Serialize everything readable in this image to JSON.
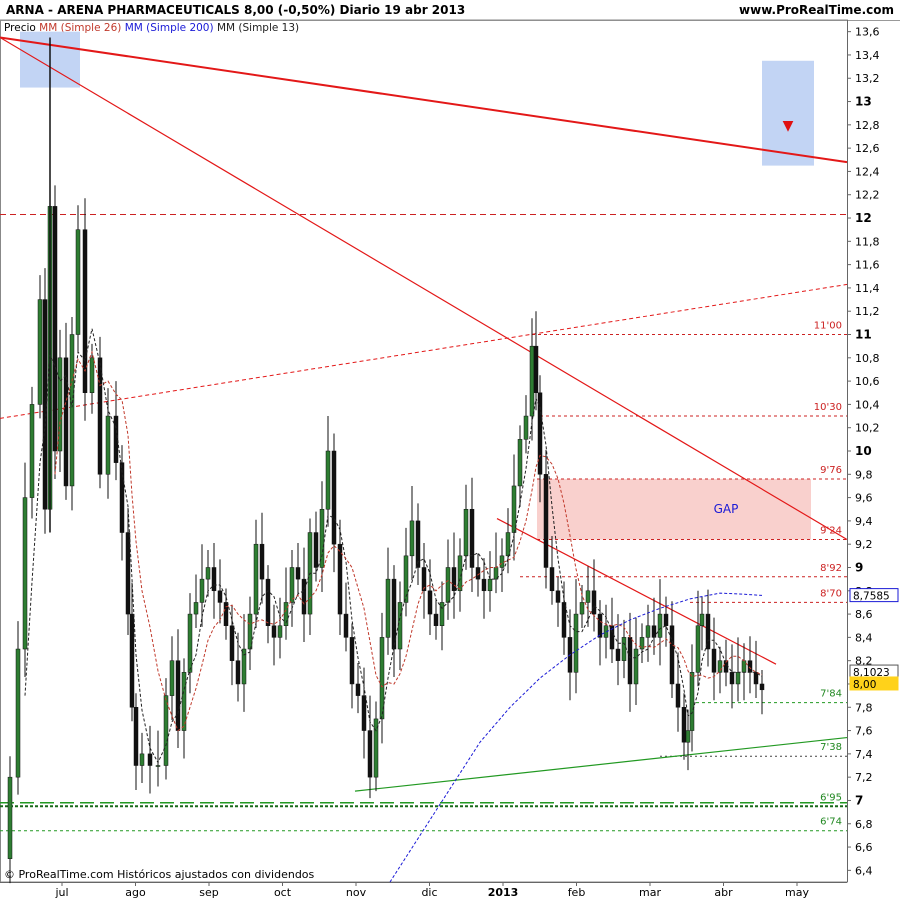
{
  "header": {
    "title": "ARNA - ARENA PHARMACEUTICALS    8,00 (-0,50%)    Diario  19 abr 2013",
    "site": "www.ProRealTime.com"
  },
  "legend": {
    "price": "Precio",
    "ma26": "MM (Simple 26)",
    "ma200": "MM (Simple 200)",
    "ma13": "MM (Simple 13)"
  },
  "footer": {
    "text": "© ProRealTime.com  Históricos ajustados con dividendos"
  },
  "colors": {
    "candle_up": "#2e7d32",
    "candle_down": "#111111",
    "ma26": "#c0392b",
    "ma200": "#1a1ad6",
    "ma13": "#222222",
    "resistance": "#ee1111",
    "support": "#229922",
    "gap_fill": "#f8c8c4",
    "blue_box": "#b7ccf2"
  },
  "chart_data": {
    "type": "candlestick",
    "symbol": "ARNA",
    "ylim": [
      6.3,
      13.7
    ],
    "yticks": [
      "13,6",
      "13,4",
      "13,2",
      "13",
      "12,8",
      "12,6",
      "12,4",
      "12,2",
      "12",
      "11,8",
      "11,6",
      "11,4",
      "11,2",
      "11",
      "10,8",
      "10,6",
      "10,4",
      "10,2",
      "10",
      "9,8",
      "9,6",
      "9,4",
      "9,2",
      "9",
      "8,8",
      "8,6",
      "8,4",
      "8,2",
      "8",
      "7,8",
      "7,6",
      "7,4",
      "7,2",
      "7",
      "6,8",
      "6,6",
      "6,4"
    ],
    "major_ticks": [
      "13",
      "12",
      "11",
      "10",
      "9",
      "7"
    ],
    "xlabels": [
      {
        "label": "jul",
        "month": 1
      },
      {
        "label": "ago",
        "month": 2
      },
      {
        "label": "sep",
        "month": 3
      },
      {
        "label": "oct",
        "month": 4
      },
      {
        "label": "nov",
        "month": 5
      },
      {
        "label": "dic",
        "month": 6
      },
      {
        "label": "2013",
        "month": 7
      },
      {
        "label": "feb",
        "month": 8
      },
      {
        "label": "mar",
        "month": 9
      },
      {
        "label": "abr",
        "month": 10
      },
      {
        "label": "may",
        "month": 11
      }
    ],
    "level_labels": [
      {
        "text": "11'00",
        "value": 11.0,
        "color": "#cc2222"
      },
      {
        "text": "10'30",
        "value": 10.3,
        "color": "#cc2222"
      },
      {
        "text": "9'76",
        "value": 9.76,
        "color": "#cc2222"
      },
      {
        "text": "9'24",
        "value": 9.24,
        "color": "#cc2222"
      },
      {
        "text": "8'92",
        "value": 8.92,
        "color": "#cc2222"
      },
      {
        "text": "8'70",
        "value": 8.7,
        "color": "#cc2222"
      },
      {
        "text": "7'84",
        "value": 7.84,
        "color": "#228822"
      },
      {
        "text": "7'38",
        "value": 7.38,
        "color": "#228822"
      },
      {
        "text": "6'95",
        "value": 6.95,
        "color": "#228822"
      },
      {
        "text": "6'74",
        "value": 6.74,
        "color": "#228822"
      }
    ],
    "value_tags": [
      {
        "text": "8,7585",
        "value": 8.7585,
        "bg": "#ffffff",
        "border": "#1a1ad6",
        "color": "#000000"
      },
      {
        "text": "8,1023",
        "value": 8.1023,
        "bg": "#ffffff",
        "border": "#555555",
        "color": "#000000"
      },
      {
        "text": "8,00",
        "value": 8.0,
        "bg": "#ffd21a",
        "border": "#ffd21a",
        "color": "#000000"
      }
    ],
    "gap_label": "GAP",
    "gap_range": [
      9.24,
      9.76
    ],
    "last_close": 8.0,
    "change_pct": -0.5
  }
}
